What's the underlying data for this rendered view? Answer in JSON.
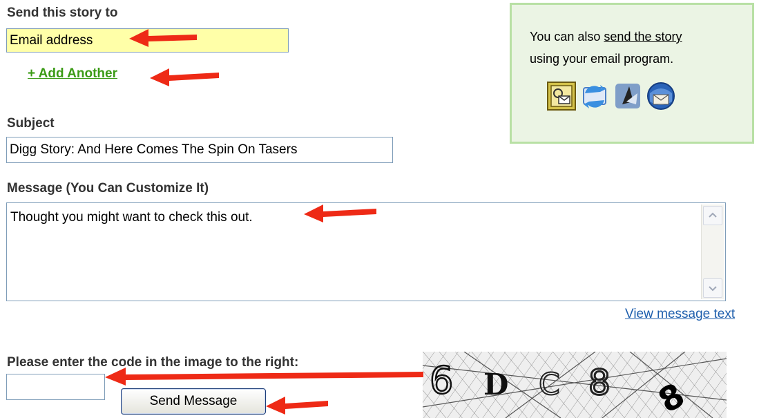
{
  "form": {
    "send_to_label": "Send this story to",
    "email_value": "Email address",
    "add_another_label": "+ Add Another",
    "subject_label": "Subject",
    "subject_value": "Digg Story: And Here Comes The Spin On Tasers",
    "message_label": "Message (You Can Customize It)",
    "message_value": "Thought you might want to check this out.",
    "view_message_text_link": "View message text",
    "captcha_label": "Please enter the code in the image to the right:",
    "captcha_value": "",
    "send_button_label": "Send Message"
  },
  "side_panel": {
    "text_before_link": "You can also ",
    "link_text": "send the story",
    "text_after_link": "using your email program.",
    "icons": [
      "outlook-icon",
      "sync-mail-icon",
      "apple-mail-icon",
      "thunderbird-icon"
    ]
  },
  "captcha_image": {
    "characters": [
      "6",
      "D",
      "C",
      "8",
      "8"
    ]
  },
  "colors": {
    "email_field_bg": "#ffffa8",
    "add_another_link": "#3b9b16",
    "link_blue": "#1f5fad",
    "side_panel_bg": "#ebf4e4",
    "side_panel_border": "#b8e0a4",
    "arrow_red": "#ee2a16"
  }
}
